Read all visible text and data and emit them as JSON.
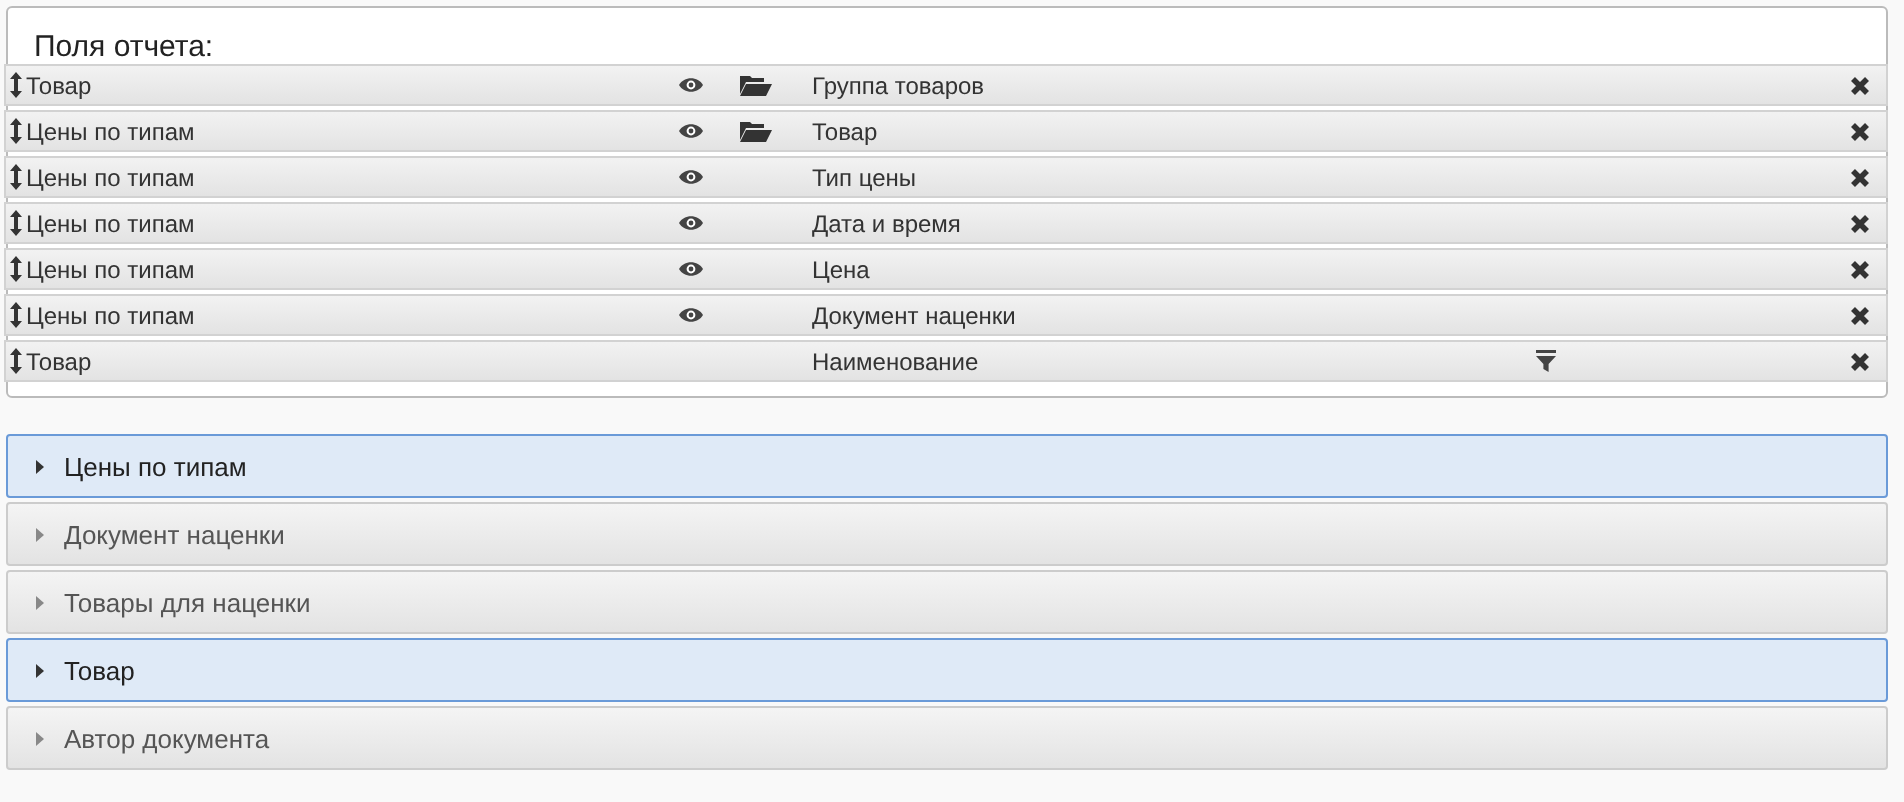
{
  "panel": {
    "title": "Поля отчета:"
  },
  "fields": [
    {
      "source": "Товар",
      "visible": true,
      "grouped": true,
      "field": "Группа товаров",
      "filtered": false
    },
    {
      "source": "Цены по типам",
      "visible": true,
      "grouped": true,
      "field": "Товар",
      "filtered": false
    },
    {
      "source": "Цены по типам",
      "visible": true,
      "grouped": false,
      "field": "Тип цены",
      "filtered": false
    },
    {
      "source": "Цены по типам",
      "visible": true,
      "grouped": false,
      "field": "Дата и время",
      "filtered": false
    },
    {
      "source": "Цены по типам",
      "visible": true,
      "grouped": false,
      "field": "Цена",
      "filtered": false
    },
    {
      "source": "Цены по типам",
      "visible": true,
      "grouped": false,
      "field": "Документ наценки",
      "filtered": false
    },
    {
      "source": "Товар",
      "visible": false,
      "grouped": false,
      "field": "Наименование",
      "filtered": true
    }
  ],
  "sections": [
    {
      "label": "Цены по типам",
      "selected": true
    },
    {
      "label": "Документ наценки",
      "selected": false
    },
    {
      "label": "Товары для наценки",
      "selected": false
    },
    {
      "label": "Товар",
      "selected": true
    },
    {
      "label": "Автор документа",
      "selected": false
    }
  ]
}
